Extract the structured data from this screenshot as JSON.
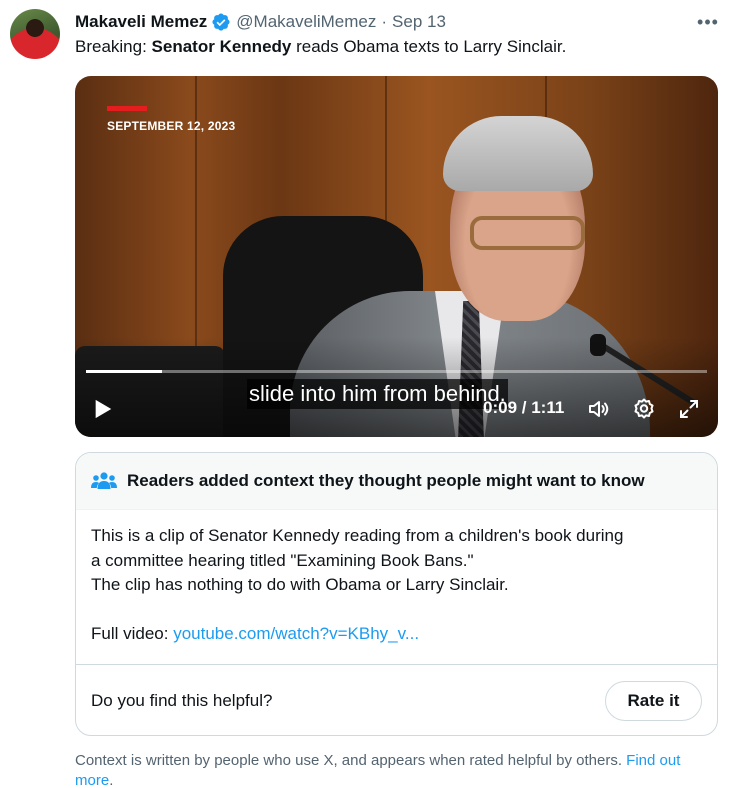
{
  "tweet": {
    "author_name": "Makaveli Memez",
    "handle": "@MakaveliMemez",
    "separator": "·",
    "date": "Sep 13",
    "more_label": "•••",
    "text_prefix": "Breaking: ",
    "text_bold": "Senator Kennedy",
    "text_suffix": " reads Obama texts to Larry Sinclair."
  },
  "video": {
    "date_overlay": "SEPTEMBER 12, 2023",
    "caption": "slide into him from behind.",
    "current_time": "0:09",
    "time_separator": " / ",
    "duration": "1:11",
    "progress_fraction": 0.123
  },
  "community_note": {
    "header": "Readers added context they thought people might want to know",
    "lines": [
      "This is a clip of Senator Kennedy reading from a children's book during",
      "a committee hearing titled \"Examining Book Bans.\"",
      "The clip has nothing to do with Obama or Larry Sinclair."
    ],
    "full_video_label": "Full video: ",
    "full_video_link": "youtube.com/watch?v=KBhy_v...",
    "helpful_question": "Do you find this helpful?",
    "rate_button": "Rate it"
  },
  "footer": {
    "text": "Context is written by people who use X, and appears when rated helpful by others.",
    "link": "Find out more",
    "period": "."
  },
  "colors": {
    "link": "#1d9bf0",
    "verified": "#1d9bf0",
    "secondary_text": "#536471",
    "date_bar": "#e41e1e"
  }
}
